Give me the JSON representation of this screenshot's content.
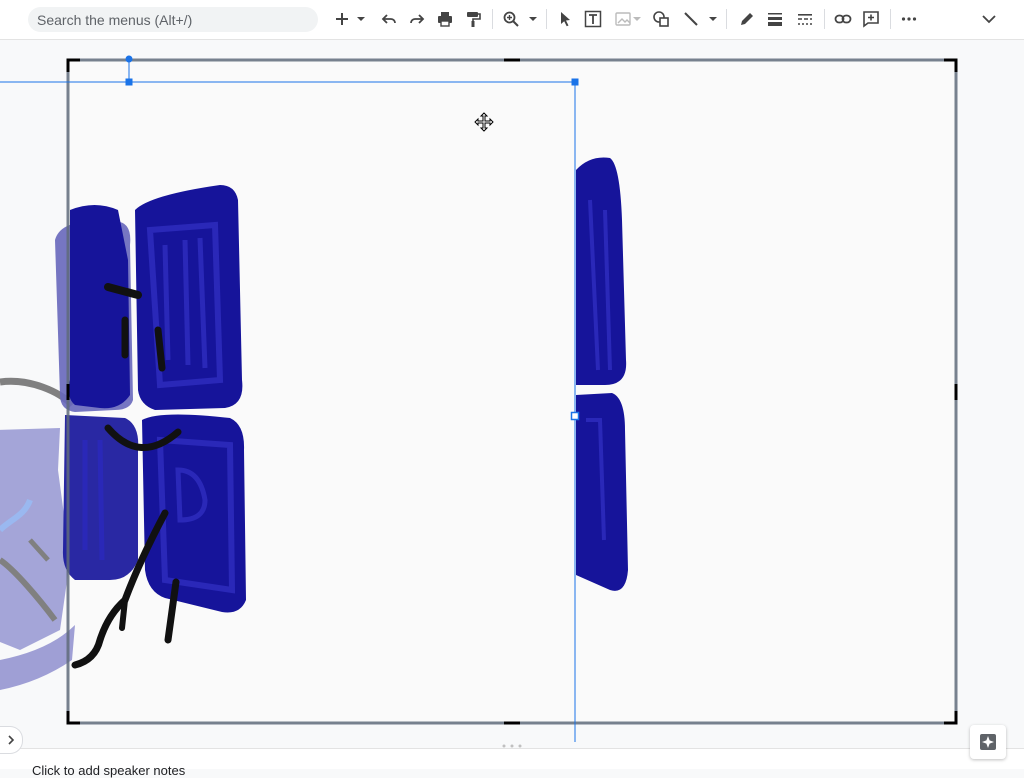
{
  "toolbar": {
    "search_placeholder": "Search the menus (Alt+/)",
    "buttons": [
      {
        "name": "new-slide-button",
        "icon": "plus-icon"
      },
      {
        "name": "new-slide-layout-dropdown",
        "icon": "caret-down-icon"
      },
      {
        "name": "undo-button",
        "icon": "undo-icon"
      },
      {
        "name": "redo-button",
        "icon": "redo-icon"
      },
      {
        "name": "print-button",
        "icon": "print-icon"
      },
      {
        "name": "paint-format-button",
        "icon": "paint-roller-icon"
      },
      {
        "name": "zoom-button",
        "icon": "zoom-icon"
      },
      {
        "name": "select-button",
        "icon": "cursor-arrow-icon"
      },
      {
        "name": "text-box-button",
        "icon": "text-box-icon"
      },
      {
        "name": "image-button",
        "icon": "image-icon"
      },
      {
        "name": "shape-button",
        "icon": "shape-icon"
      },
      {
        "name": "line-button",
        "icon": "line-icon"
      },
      {
        "name": "border-color-button",
        "icon": "pencil-icon"
      },
      {
        "name": "border-weight-button",
        "icon": "border-weight-icon"
      },
      {
        "name": "border-dash-button",
        "icon": "border-dash-icon"
      },
      {
        "name": "insert-link-button",
        "icon": "link-icon"
      },
      {
        "name": "add-comment-button",
        "icon": "comment-plus-icon"
      },
      {
        "name": "more-options-button",
        "icon": "more-horiz-icon"
      },
      {
        "name": "collapse-toolbar-button",
        "icon": "chevron-down-icon"
      }
    ]
  },
  "bottom": {
    "speaker_notes_text": "Click to add speaker notes"
  },
  "colors": {
    "ink_navy": "#16149a",
    "ink_black": "#111111",
    "ink_grey": "#808080",
    "ink_lightblue": "#9ab8f0",
    "selection_blue": "#1a73e8"
  }
}
